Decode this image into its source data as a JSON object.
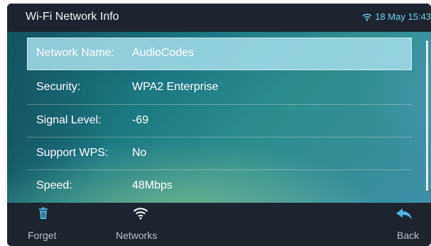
{
  "header": {
    "title": "Wi-Fi Network Info",
    "date": "18 May",
    "time": "15:43"
  },
  "info_rows": [
    {
      "label": "Network Name:",
      "value": "AudioCodes",
      "selected": true
    },
    {
      "label": "Security:",
      "value": "WPA2 Enterprise"
    },
    {
      "label": "Signal Level:",
      "value": "-69"
    },
    {
      "label": "Support WPS:",
      "value": "No"
    },
    {
      "label": "Speed:",
      "value": "48Mbps"
    }
  ],
  "softkeys": {
    "forget": {
      "label": "Forget",
      "icon": "trash-icon"
    },
    "networks": {
      "label": "Networks",
      "icon": "wifi-icon"
    },
    "back": {
      "label": "Back",
      "icon": "back-arrow-icon"
    }
  },
  "colors": {
    "bar_background": "#1d2430",
    "accent": "#6fd0e8",
    "selected_row": "#a0dce6"
  }
}
